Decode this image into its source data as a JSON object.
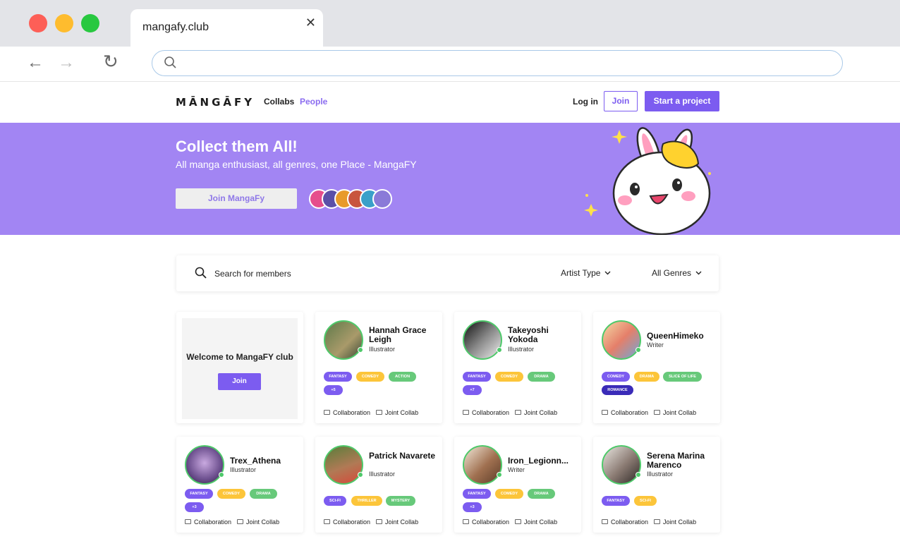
{
  "browser": {
    "tab_title": "mangafy.club",
    "tab_close": "✕",
    "back": "←",
    "forward": "→",
    "reload": "↻"
  },
  "header": {
    "logo": "MĀNGĀFY",
    "nav": [
      "Collabs",
      "People"
    ],
    "login": "Log in",
    "join": "Join",
    "start_project": "Start a project",
    "accent_color": "#7c5cf0"
  },
  "hero": {
    "title": "Collect them All!",
    "subtitle": "All manga enthusiast, all genres, one Place - MangaFY",
    "join_button": "Join MangaFy",
    "background_color": "#a285f3"
  },
  "search": {
    "placeholder": "Search for members",
    "artist_type": "Artist Type",
    "genres": "All Genres"
  },
  "welcome_card": {
    "text": "Welcome to MangaFY club",
    "join": "Join"
  },
  "footer_labels": {
    "collab": "Collaboration",
    "joint": "Joint Collab"
  },
  "members": [
    {
      "name": "Hannah Grace Leigh",
      "role": "Illustrator",
      "tags": [
        "FANTASY",
        "COMEDY",
        "ACTION",
        "+5"
      ]
    },
    {
      "name": "Takeyoshi Yokoda",
      "role": "Illustrator",
      "tags": [
        "FANTASY",
        "COMEDY",
        "DRAMA",
        "+7"
      ]
    },
    {
      "name": "QueenHimeko",
      "role": "Writer",
      "tags": [
        "COMEDY",
        "DRAMA",
        "SLICE OF LIFE",
        "ROMANCE"
      ]
    },
    {
      "name": "Trex_Athena",
      "role": "Illustrator",
      "tags": [
        "FANTASY",
        "COMEDY",
        "DRAMA",
        "+3"
      ]
    },
    {
      "name": "Patrick Navarete",
      "role": "Illustrator",
      "tags": [
        "SCI-FI",
        "THRILLER",
        "MYSTERY"
      ]
    },
    {
      "name": "Iron_Legionn...",
      "role": "Writer",
      "tags": [
        "FANTASY",
        "COMEDY",
        "DRAMA",
        "+3"
      ]
    },
    {
      "name": "Serena Marina Marenco",
      "role": "Illustrator",
      "tags": [
        "FANTASY",
        "SCI-FI"
      ]
    }
  ]
}
